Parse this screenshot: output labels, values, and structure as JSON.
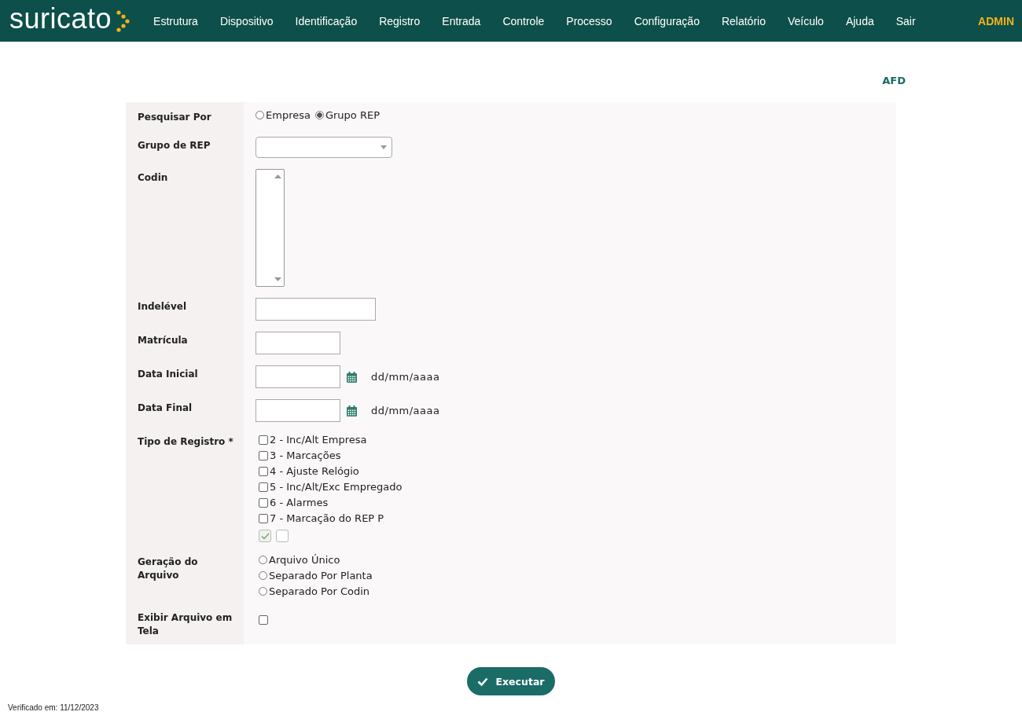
{
  "header": {
    "logo": "suricato",
    "menu": [
      "Estrutura",
      "Dispositivo",
      "Identificação",
      "Registro",
      "Entrada",
      "Controle",
      "Processo",
      "Configuração",
      "Relatório",
      "Veículo",
      "Ajuda",
      "Sair"
    ],
    "user": "ADMIN"
  },
  "page_title": "AFD",
  "form": [
    {
      "kind": "radio",
      "label": "Pesquisar Por",
      "options": [
        {
          "label": "Empresa",
          "selected": false
        },
        {
          "label": "Grupo REP",
          "selected": true
        }
      ]
    },
    {
      "kind": "select",
      "label": "Grupo de REP"
    },
    {
      "kind": "listbox",
      "label": "Codin"
    },
    {
      "kind": "wide_text",
      "label": "Indelével"
    },
    {
      "kind": "short_text",
      "label": "Matrícula"
    },
    {
      "kind": "date",
      "label": "Data Inicial",
      "hint": "dd/mm/aaaa"
    },
    {
      "kind": "date",
      "label": "Data Final",
      "hint": "dd/mm/aaaa"
    },
    {
      "kind": "checklist",
      "label": "Tipo de Registro *",
      "options": [
        {
          "label": "2 - Inc/Alt Empresa",
          "checked": false
        },
        {
          "label": "3 - Marcações",
          "checked": false
        },
        {
          "label": "4 - Ajuste Relógio",
          "checked": false
        },
        {
          "label": "5 - Inc/Alt/Exc Empregado",
          "checked": false
        },
        {
          "label": "6 - Alarmes",
          "checked": false
        },
        {
          "label": "7 - Marcação do REP P",
          "checked": false
        }
      ],
      "toggles": [
        {
          "checked": true
        },
        {
          "checked": false
        }
      ]
    },
    {
      "kind": "radiolist",
      "label": "Geração do Arquivo",
      "options": [
        {
          "label": "Arquivo Único",
          "selected": false
        },
        {
          "label": "Separado Por Planta",
          "selected": false
        },
        {
          "label": "Separado Por Codin",
          "selected": false
        }
      ]
    },
    {
      "kind": "checkbox",
      "label": "Exibir Arquivo em Tela",
      "checked": false
    }
  ],
  "submit": "Executar",
  "footer": "Verificado em: 11/12/2023"
}
